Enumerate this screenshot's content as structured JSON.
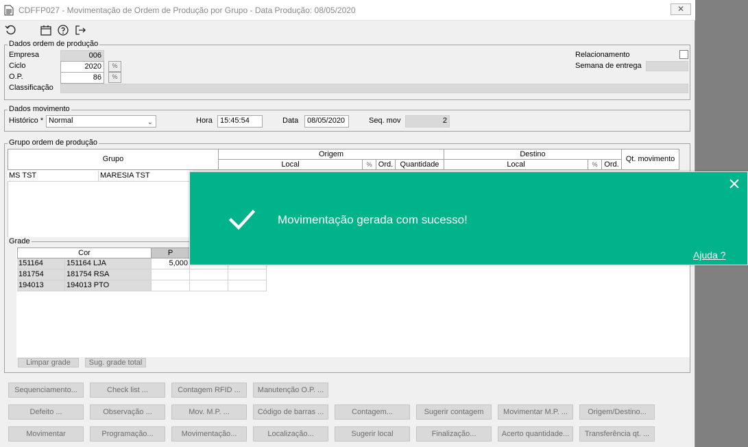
{
  "window": {
    "title": "CDFFP027 - Movimentação de Ordem de Produção por Grupo - Data Produção: 08/05/2020",
    "close_label": "✕"
  },
  "toolbar": {
    "icons": [
      "refresh-icon",
      "calendar-icon",
      "help-icon",
      "exit-icon"
    ]
  },
  "dados_op": {
    "title": "Dados ordem de produção",
    "empresa_label": "Empresa",
    "empresa_value": "006",
    "ciclo_label": "Ciclo",
    "ciclo_value": "2020",
    "op_label": "O.P.",
    "op_value": "86",
    "classificacao_label": "Classificação",
    "classificacao_value": "",
    "relacionamento_label": "Relacionamento",
    "semana_label": "Semana de entrega",
    "semana_value": ""
  },
  "dados_mov": {
    "title": "Dados movimento",
    "historico_label": "Histórico *",
    "historico_value": "Normal",
    "hora_label": "Hora",
    "hora_value": "15:45:54",
    "data_label": "Data",
    "data_value": "08/05/2020",
    "seq_label": "Seq. mov",
    "seq_value": "2"
  },
  "grupo_op": {
    "title": "Grupo ordem de produção",
    "headers": {
      "grupo": "Grupo",
      "origem": "Origem",
      "origem_local": "Local",
      "origem_ord": "Ord.",
      "origem_qtd": "Quantidade",
      "destino": "Destino",
      "destino_local": "Local",
      "destino_ord": "Ord.",
      "qt_mov": "Qt. movimento"
    },
    "rows": [
      {
        "codigo": "MS TST",
        "descricao": "MARESIA TST"
      }
    ]
  },
  "grade": {
    "title": "Grade",
    "col_cor": "Cor",
    "col_p": "P",
    "rows": [
      {
        "codigo": "151164",
        "descricao": "151164 LJA",
        "p": "5,000"
      },
      {
        "codigo": "181754",
        "descricao": "181754 RSA",
        "p": ""
      },
      {
        "codigo": "194013",
        "descricao": "194013 PTO",
        "p": ""
      }
    ],
    "btn_limpar": "Limpar grade",
    "btn_sug": "Sug. grade total"
  },
  "buttons": {
    "row1": [
      "Sequenciamento...",
      "Check list ...",
      "Contagem RFID ...",
      "Manutenção O.P. ..."
    ],
    "row2": [
      "Defeito ...",
      "Observação ...",
      "Mov. M.P. ...",
      "Código de barras ...",
      "Contagem...",
      "Sugerir contagem",
      "Movimentar M.P. ...",
      "Origem/Destino..."
    ],
    "row3": [
      "Movimentar",
      "Programação...",
      "Movimentação...",
      "Localização...",
      "Sugerir local",
      "Finalização...",
      "Acerto quantidade...",
      "Transferência qt. ..."
    ]
  },
  "toast": {
    "message": "Movimentação gerada com sucesso!",
    "help": "Ajuda ?",
    "color": "#00b38a"
  }
}
